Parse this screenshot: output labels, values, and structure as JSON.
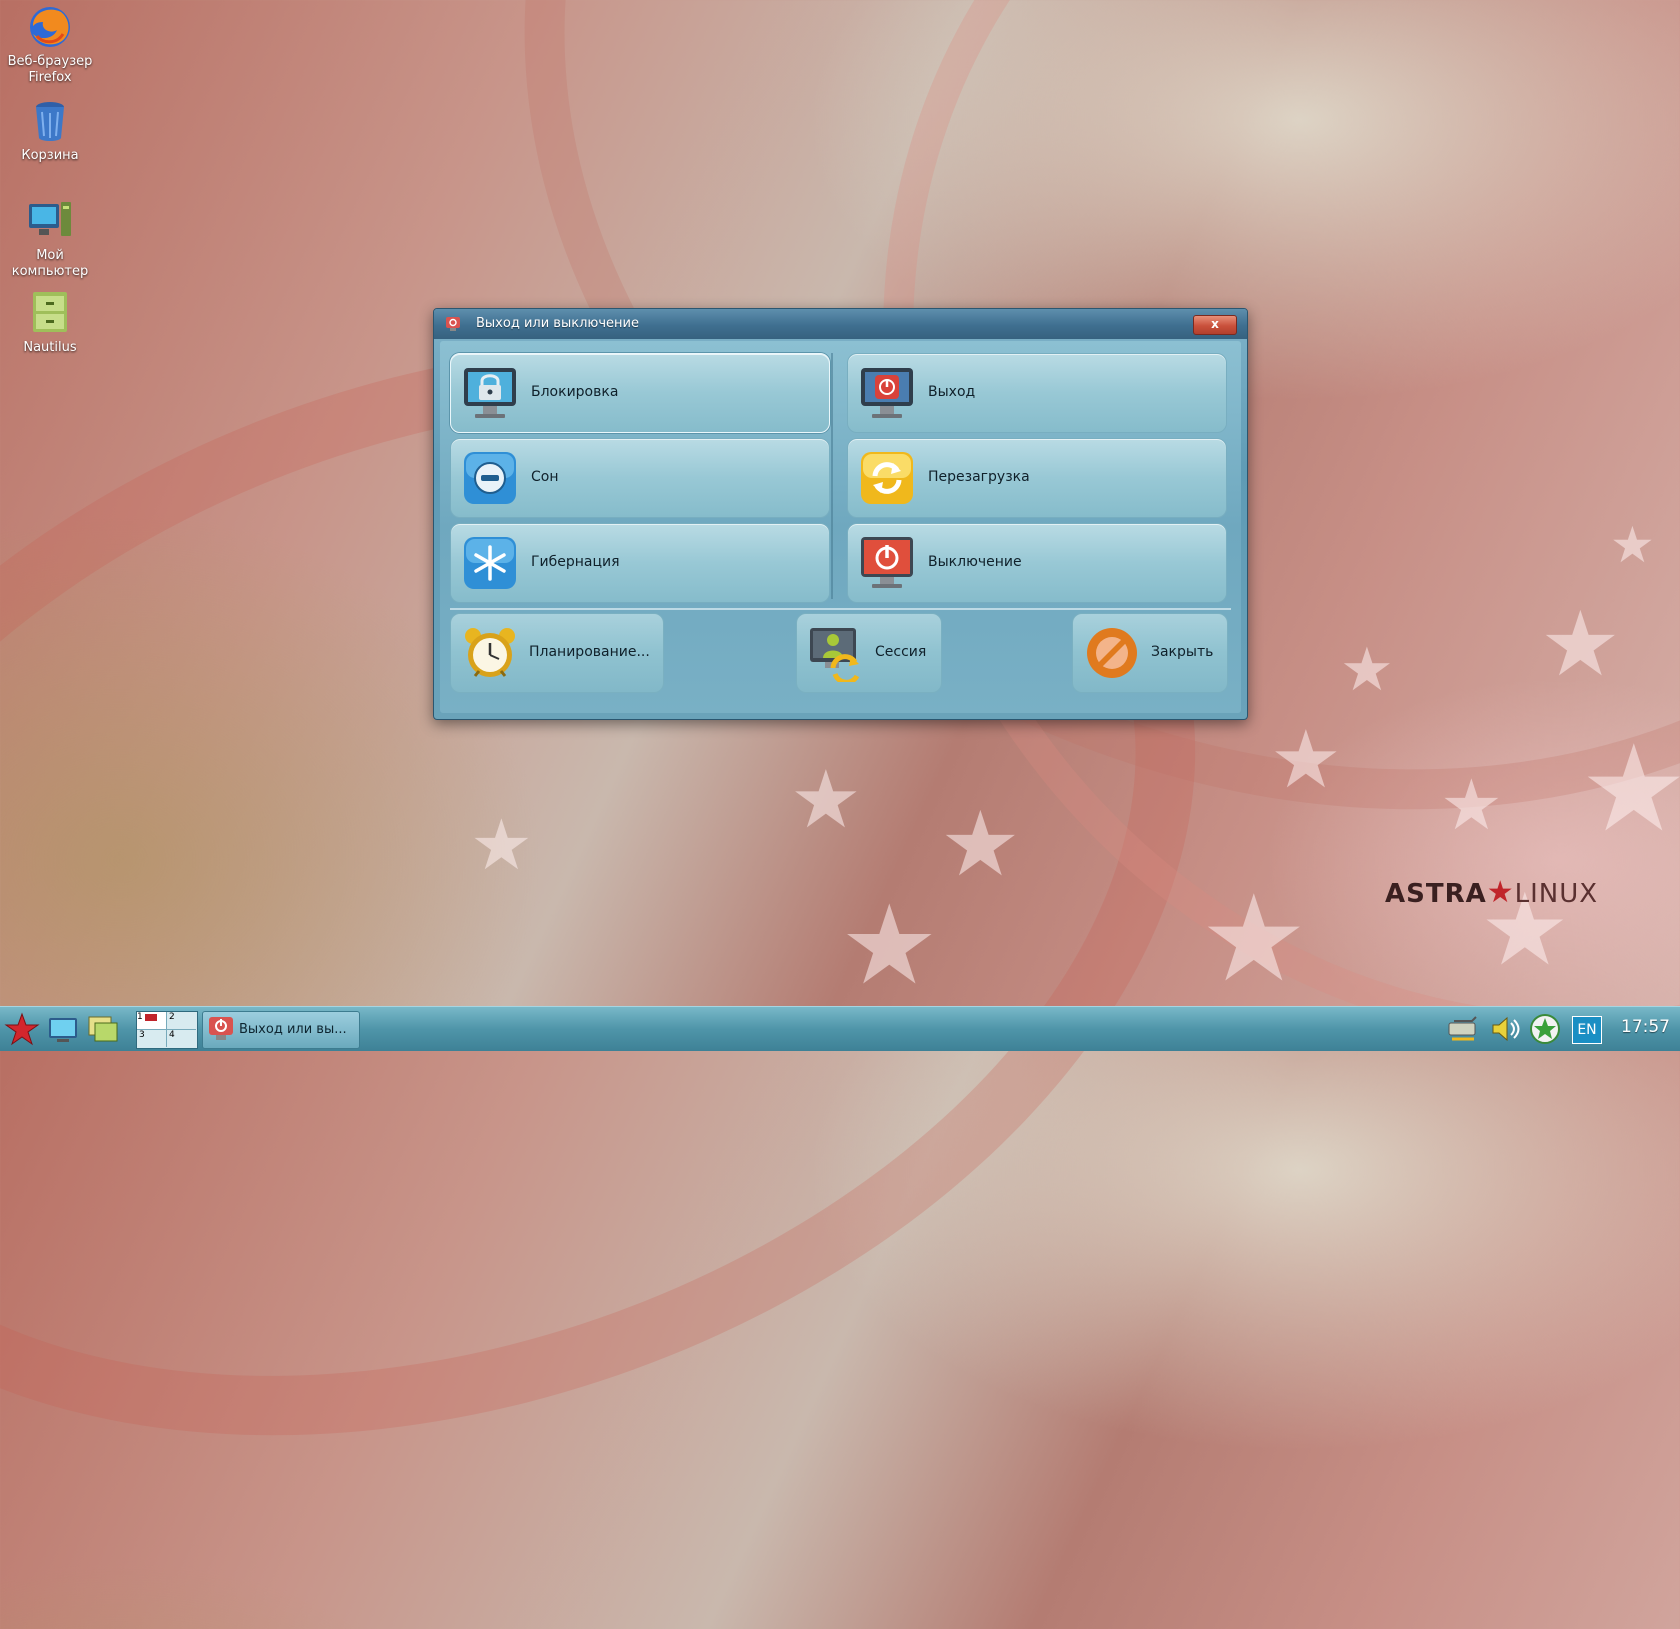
{
  "desktop": {
    "icons": [
      {
        "label_line1": "Веб-браузер",
        "label_line2": "Firefox",
        "icon": "firefox-icon"
      },
      {
        "label_line1": "Корзина",
        "label_line2": "",
        "icon": "trash-icon"
      },
      {
        "label_line1": "Мой",
        "label_line2": "компьютер",
        "icon": "computer-icon"
      },
      {
        "label_line1": "Nautilus",
        "label_line2": "",
        "icon": "file-cabinet-icon"
      }
    ],
    "brand": {
      "part1": "ASTRA",
      "part2": "LINUX"
    }
  },
  "dialog": {
    "title": "Выход или выключение",
    "close_label": "x",
    "buttons": {
      "lock": "Блокировка",
      "sleep": "Сон",
      "hibernate": "Гибернация",
      "logout": "Выход",
      "restart": "Перезагрузка",
      "shutdown": "Выключение",
      "schedule": "Планирование...",
      "session": "Сессия",
      "close": "Закрыть"
    }
  },
  "taskbar": {
    "task_title": "Выход или вы...",
    "language": "EN",
    "clock": "17:57",
    "pager": [
      "1",
      "2",
      "3",
      "4"
    ]
  },
  "colors": {
    "accent": "#4f95a9",
    "dialog_title": "#3f6f90",
    "close_red": "#c9503b"
  }
}
